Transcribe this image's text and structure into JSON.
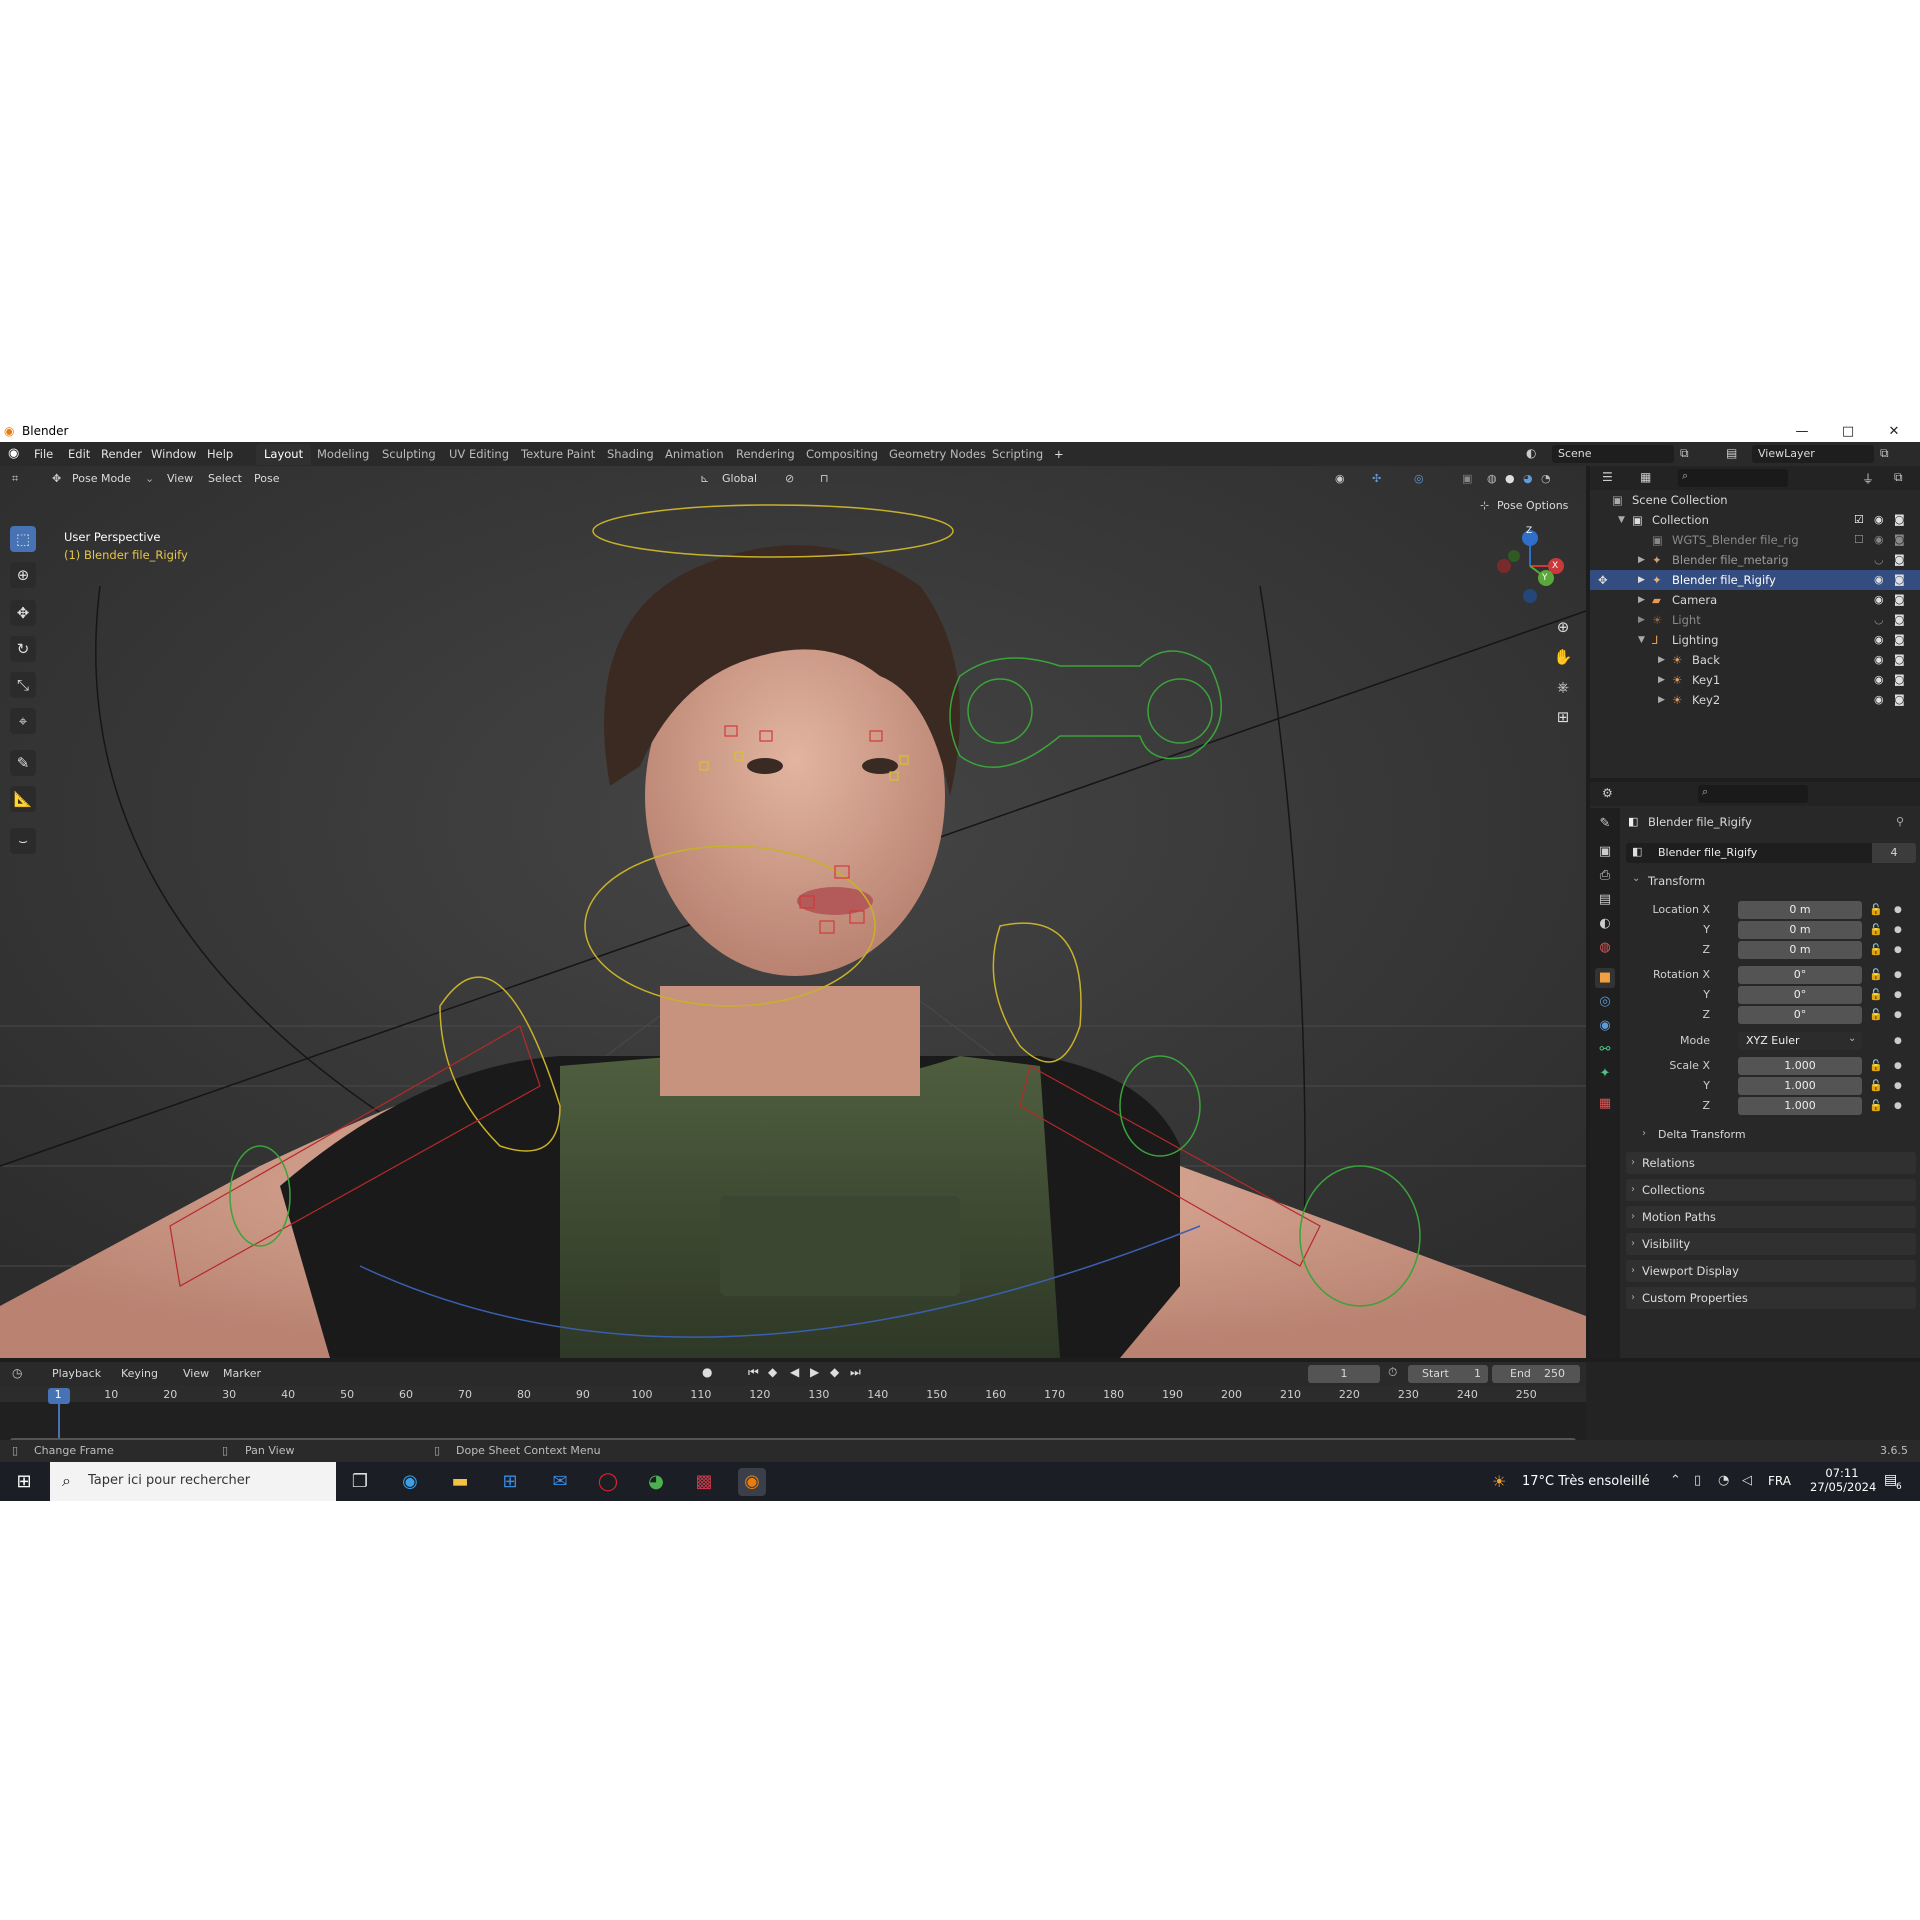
{
  "window": {
    "title": "Blender",
    "minimize": "—",
    "maximize": "□",
    "close": "✕"
  },
  "menubar": {
    "items": [
      "File",
      "Edit",
      "Render",
      "Window",
      "Help"
    ],
    "workspaces": [
      "Layout",
      "Modeling",
      "Sculpting",
      "UV Editing",
      "Texture Paint",
      "Shading",
      "Animation",
      "Rendering",
      "Compositing",
      "Geometry Nodes",
      "Scripting"
    ],
    "add_workspace": "+",
    "scene": "Scene",
    "view_layer": "ViewLayer"
  },
  "viewport": {
    "mode": "Pose Mode",
    "menus": [
      "View",
      "Select",
      "Pose"
    ],
    "transform_orientation": "Global",
    "pose_options": "Pose Options",
    "overlay_title": "User Perspective",
    "overlay_object": "(1) Blender file_Rigify",
    "gizmo_axes": [
      "Z",
      "Y",
      "X"
    ]
  },
  "outliner": {
    "rows": [
      {
        "name": "Scene Collection"
      },
      {
        "name": "Collection"
      },
      {
        "name": "WGTS_Blender file_rig"
      },
      {
        "name": "Blender file_metarig"
      },
      {
        "name": "Blender file_Rigify"
      },
      {
        "name": "Camera"
      },
      {
        "name": "Light"
      },
      {
        "name": "Lighting"
      },
      {
        "name": "Back"
      },
      {
        "name": "Key1"
      },
      {
        "name": "Key2"
      }
    ]
  },
  "properties": {
    "object_name": "Blender file_Rigify",
    "data_name": "Blender file_Rigify",
    "users": "4",
    "transform_header": "Transform",
    "location_label": "Location X",
    "rotation_label": "Rotation X",
    "scale_label": "Scale X",
    "axis_y": "Y",
    "axis_z": "Z",
    "location": [
      "0 m",
      "0 m",
      "0 m"
    ],
    "rotation": [
      "0°",
      "0°",
      "0°"
    ],
    "mode_label": "Mode",
    "mode_value": "XYZ Euler",
    "scale": [
      "1.000",
      "1.000",
      "1.000"
    ],
    "delta_transform": "Delta Transform",
    "panels": [
      "Relations",
      "Collections",
      "Motion Paths",
      "Visibility",
      "Viewport Display",
      "Custom Properties"
    ]
  },
  "timeline": {
    "menus": [
      "Playback",
      "Keying",
      "View",
      "Marker"
    ],
    "current_frame": "1",
    "start_label": "Start",
    "start": "1",
    "end_label": "End",
    "end": "250",
    "ticks": [
      "1",
      "10",
      "20",
      "30",
      "40",
      "50",
      "60",
      "70",
      "80",
      "90",
      "100",
      "110",
      "120",
      "130",
      "140",
      "150",
      "160",
      "170",
      "180",
      "190",
      "200",
      "210",
      "220",
      "230",
      "240",
      "250"
    ]
  },
  "statusbar": {
    "hints": [
      "Change Frame",
      "Pan View",
      "Dope Sheet Context Menu"
    ],
    "version": "3.6.5"
  },
  "taskbar": {
    "search_placeholder": "Taper ici pour rechercher",
    "weather": "17°C  Très ensoleillé",
    "language": "FRA",
    "time": "07:11",
    "date": "27/05/2024",
    "notifications": "6"
  }
}
